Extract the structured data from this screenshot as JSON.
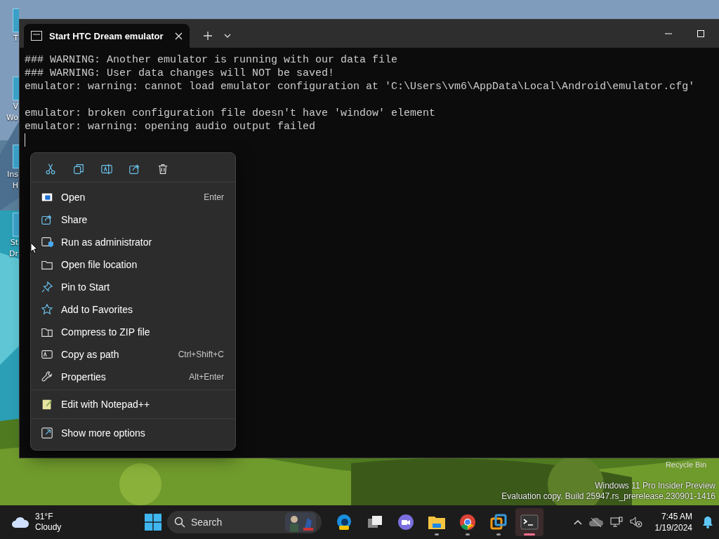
{
  "desktop": {
    "icons": [
      {
        "lines": [
          "T"
        ]
      },
      {
        "lines": [
          "V",
          "Wo"
        ]
      },
      {
        "lines": [
          "Ins",
          "H"
        ]
      },
      {
        "lines": [
          "St",
          "Dr"
        ]
      }
    ],
    "recycle_bin": "Recycle Bin",
    "watermark": [
      "Windows 11 Pro Insider Preview",
      "Evaluation copy. Build 25947.rs_prerelease.230901-1416"
    ]
  },
  "window": {
    "tab": {
      "title": "Start HTC Dream emulator",
      "selected": true
    },
    "lines": [
      {
        "kind": "text",
        "text": "### WARNING: Another emulator is running with our data file"
      },
      {
        "kind": "text",
        "text": "### WARNING: User data changes will NOT be saved!"
      },
      {
        "kind": "text",
        "text": "emulator: warning: cannot load emulator configuration at 'C:\\Users\\vm6\\AppData\\Local\\Android\\emulator.cfg'"
      },
      {
        "kind": "blank"
      },
      {
        "kind": "text",
        "text": "emulator: broken configuration file doesn't have 'window' element"
      },
      {
        "kind": "text",
        "text": "emulator: warning: opening audio output failed"
      },
      {
        "kind": "blank"
      }
    ]
  },
  "context_menu": {
    "sections": [
      [
        {
          "label": "Open",
          "shortcut": "Enter"
        },
        {
          "label": "Share"
        },
        {
          "label": "Run as administrator"
        },
        {
          "label": "Open file location"
        },
        {
          "label": "Pin to Start"
        },
        {
          "label": "Add to Favorites"
        },
        {
          "label": "Compress to ZIP file"
        },
        {
          "label": "Copy as path",
          "shortcut": "Ctrl+Shift+C"
        },
        {
          "label": "Properties",
          "shortcut": "Alt+Enter"
        }
      ],
      [
        {
          "label": "Edit with Notepad++"
        }
      ],
      [
        {
          "label": "Show more options"
        }
      ]
    ]
  },
  "taskbar": {
    "weather": {
      "temperature": "31°F",
      "condition": "Cloudy"
    },
    "search": {
      "placeholder": "Search"
    },
    "apps": [
      {
        "running": false,
        "selected": false
      },
      {
        "running": false,
        "selected": false
      },
      {
        "running": false,
        "selected": false
      },
      {
        "running": true,
        "selected": false
      },
      {
        "running": true,
        "selected": false
      },
      {
        "running": true,
        "selected": false
      },
      {
        "running": true,
        "selected": true
      }
    ],
    "clock": {
      "time": "7:45 AM",
      "date": "1/19/2024"
    }
  }
}
